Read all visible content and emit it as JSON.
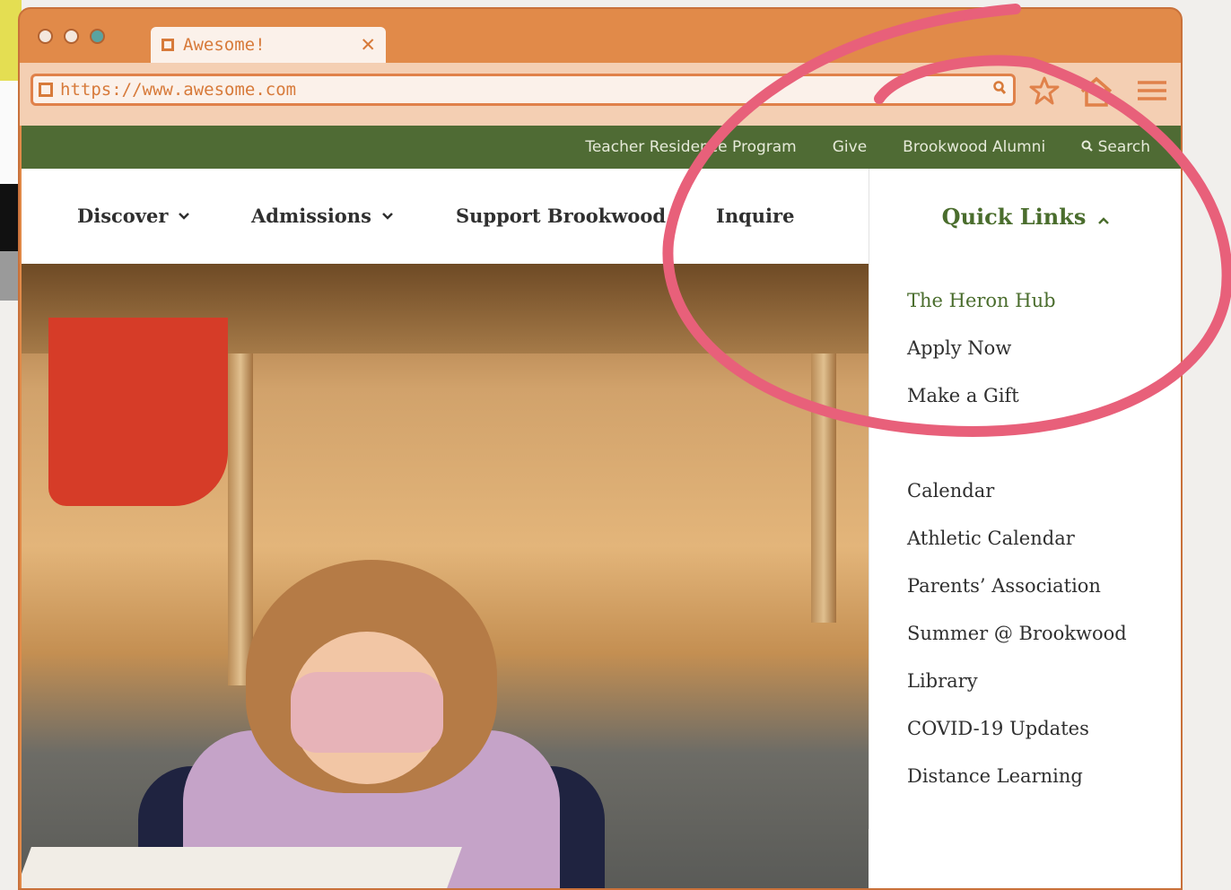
{
  "browser": {
    "tab_title": "Awesome!",
    "close_glyph": "✕",
    "url": "https://www.awesome.com",
    "window_dots": [
      "#f4e8de",
      "#f4e8de",
      "#5aa3a0"
    ],
    "icons": [
      "search-icon",
      "star-icon",
      "home-icon",
      "menu-icon"
    ]
  },
  "utility_nav": {
    "items": [
      "Teacher Residence Program",
      "Give",
      "Brookwood Alumni"
    ],
    "search_label": "Search"
  },
  "main_nav": {
    "discover": "Discover",
    "admissions": "Admissions",
    "support": "Support Brookwood",
    "inquire": "Inquire",
    "quick_links": "Quick Links"
  },
  "quick_links": [
    "The Heron Hub",
    "Apply Now",
    "Make a Gift",
    "",
    "Calendar",
    "Athletic Calendar",
    "Parents’ Association",
    "Summer @ Brookwood",
    "Library",
    "COVID-19 Updates",
    "Distance Learning"
  ],
  "colors": {
    "browser_frame": "#e18a49",
    "utility_bar": "#4f6b34",
    "accent_green": "#4a6d2d",
    "annotation": "#e8607a"
  }
}
